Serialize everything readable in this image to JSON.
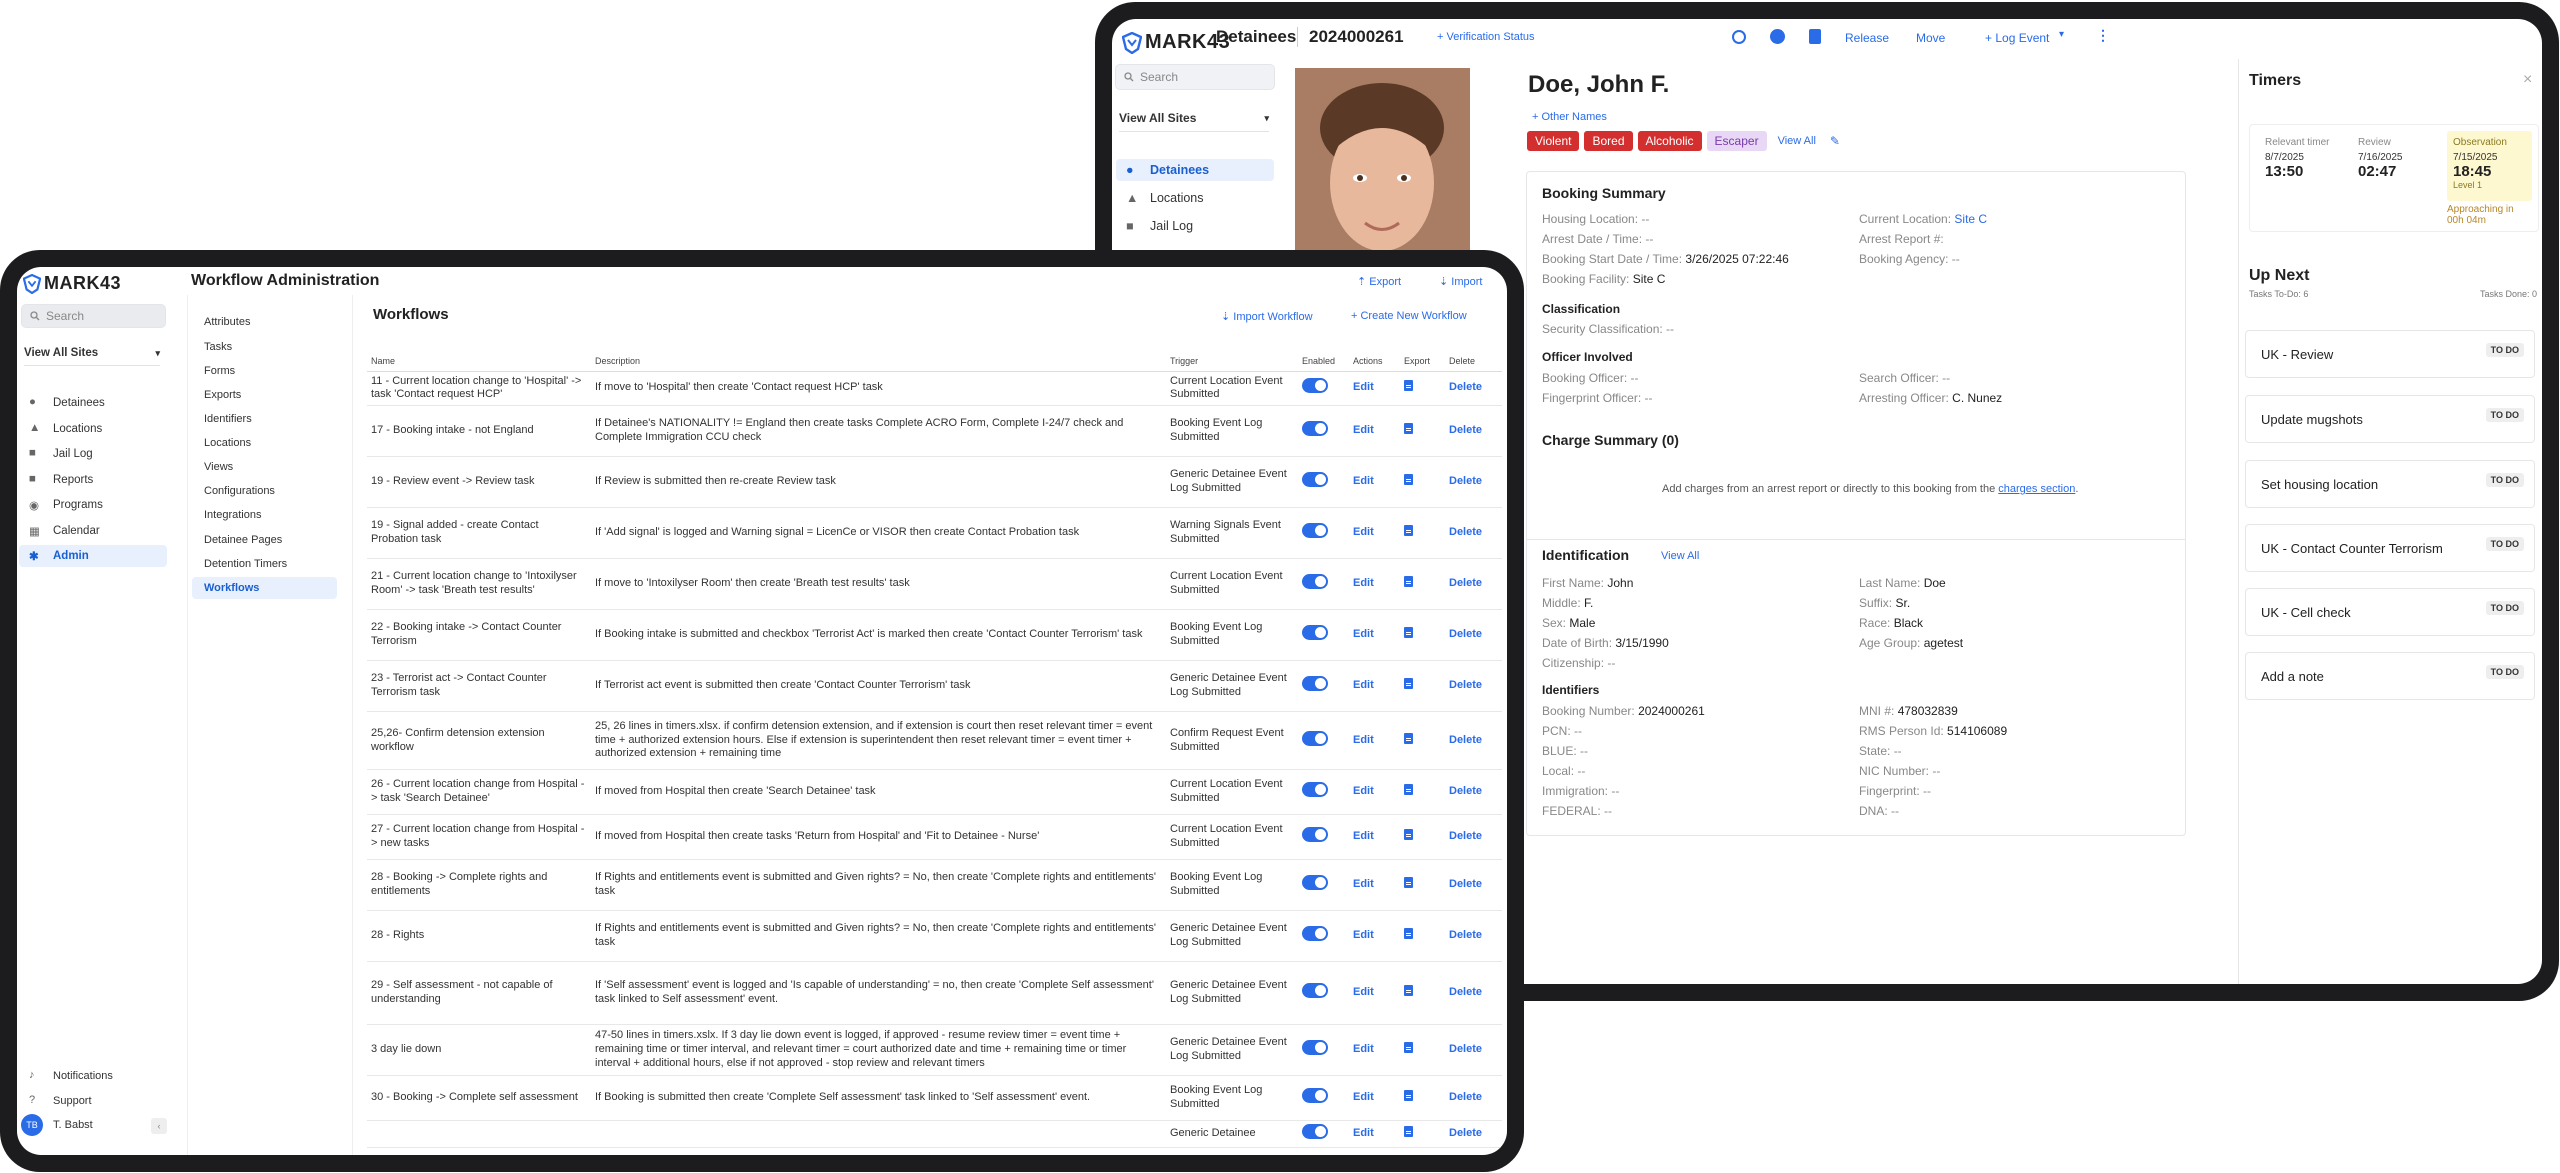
{
  "back": {
    "brand": "MARK43",
    "page_title": "Detainees",
    "booking_id": "2024000261",
    "verification_link": "Verification Status",
    "actions": [
      "Release",
      "Move",
      "Log Event"
    ],
    "search_placeholder": "Search",
    "site_selector": "View All Sites",
    "nav": [
      "Detainees",
      "Locations",
      "Jail Log"
    ],
    "person_name": "Doe, John F.",
    "other_names_link": "Other Names",
    "tags": [
      {
        "label": "Violent",
        "color": "#d32f2f"
      },
      {
        "label": "Bored",
        "color": "#d32f2f"
      },
      {
        "label": "Alcoholic",
        "color": "#d32f2f"
      },
      {
        "label": "Escaper",
        "color": "#e8d8f5"
      }
    ],
    "view_all": "View All",
    "booking_summary": {
      "heading": "Booking Summary",
      "housing_location": "Housing Location: --",
      "current_location_label": "Current Location:",
      "current_location": "Site C",
      "arrest_datetime": "Arrest Date / Time: --",
      "arrest_report": "Arrest Report #:",
      "booking_start_label": "Booking Start Date / Time:",
      "booking_start": "3/26/2025 07:22:46",
      "booking_agency": "Booking Agency: --",
      "booking_facility_label": "Booking Facility:",
      "booking_facility": "Site C",
      "classification_heading": "Classification",
      "security_classification": "Security Classification: --",
      "officer_heading": "Officer Involved",
      "booking_officer": "Booking Officer: --",
      "search_officer": "Search Officer: --",
      "fingerprint_officer": "Fingerprint Officer: --",
      "arresting_officer_label": "Arresting Officer:",
      "arresting_officer": "C. Nunez"
    },
    "charge_summary": {
      "heading": "Charge Summary (0)",
      "text": "Add charges from an arrest report or directly to this booking from the",
      "link": "charges section"
    },
    "identification": {
      "heading": "Identification",
      "view_all": "View All",
      "first_name_label": "First Name:",
      "first_name": "John",
      "last_name_label": "Last Name:",
      "last_name": "Doe",
      "middle_label": "Middle:",
      "middle": "F.",
      "suffix_label": "Suffix:",
      "suffix": "Sr.",
      "sex_label": "Sex:",
      "sex": "Male",
      "race_label": "Race:",
      "race": "Black",
      "dob_label": "Date of Birth:",
      "dob": "3/15/1990",
      "age_group_label": "Age Group:",
      "age_group": "agetest",
      "citizenship": "Citizenship: --"
    },
    "identifiers": {
      "heading": "Identifiers",
      "booking_number_label": "Booking Number:",
      "booking_number": "2024000261",
      "mni_label": "MNI #:",
      "mni": "478032839",
      "pcn": "PCN: --",
      "rms_label": "RMS Person Id:",
      "rms": "514106089",
      "blue": "BLUE: --",
      "state": "State: --",
      "local": "Local: --",
      "nic": "NIC Number: --",
      "immigration": "Immigration: --",
      "fingerprint": "Fingerprint: --",
      "federal": "FEDERAL: --",
      "dna": "DNA: --"
    },
    "timers": {
      "title": "Timers",
      "items": [
        {
          "label": "Relevant timer",
          "date": "8/7/2025",
          "time": "13:50"
        },
        {
          "label": "Review",
          "date": "7/16/2025",
          "time": "02:47"
        },
        {
          "label": "Observation",
          "date": "7/15/2025",
          "time": "18:45",
          "sub": "Level 1"
        }
      ],
      "approaching": "Approaching in 00h 04m",
      "up_next": "Up Next",
      "tasks_todo": "Tasks To-Do: 6",
      "tasks_done": "Tasks Done: 0",
      "tasks": [
        "UK - Review",
        "Update mugshots",
        "Set housing location",
        "UK - Contact Counter Terrorism",
        "UK - Cell check",
        "Add a note"
      ],
      "todo_badge": "TO DO"
    }
  },
  "front": {
    "brand": "MARK43",
    "page_title": "Workflow Administration",
    "export": "Export",
    "import": "Import",
    "search_placeholder": "Search",
    "site_selector": "View All Sites",
    "nav": [
      "Detainees",
      "Locations",
      "Jail Log",
      "Reports",
      "Programs",
      "Calendar",
      "Admin"
    ],
    "footer": [
      "Notifications",
      "Support"
    ],
    "user_initials": "TB",
    "user_name": "T. Babst",
    "admin_menu": [
      "Attributes",
      "Tasks",
      "Forms",
      "Exports",
      "Identifiers",
      "Locations",
      "Views",
      "Configurations",
      "Integrations",
      "Detainee Pages",
      "Detention Timers",
      "Workflows"
    ],
    "section_title": "Workflows",
    "import_workflow": "Import Workflow",
    "create_workflow": "Create New Workflow",
    "columns": [
      "Name",
      "Description",
      "Trigger",
      "Enabled",
      "Actions",
      "Export",
      "Delete"
    ],
    "edit_label": "Edit",
    "delete_label": "Delete",
    "rows": [
      {
        "name": "11 - Current location change to 'Hospital' -> task 'Contact request HCP'",
        "desc": "If move to 'Hospital' then create 'Contact request HCP' task",
        "trigger": "Current Location Event Submitted"
      },
      {
        "name": "17 - Booking intake - not England",
        "desc": "If Detainee's NATIONALITY != England then create tasks Complete ACRO Form, Complete I-24/7 check and Complete Immigration CCU check",
        "trigger": "Booking Event Log Submitted"
      },
      {
        "name": "19 - Review event -> Review task",
        "desc": "If Review is submitted then re-create Review task",
        "trigger": "Generic Detainee Event Log Submitted"
      },
      {
        "name": "19 - Signal added - create Contact Probation task",
        "desc": "If 'Add signal' is logged and Warning signal = LicenCe or VISOR then create Contact Probation task",
        "trigger": "Warning Signals Event Submitted"
      },
      {
        "name": "21 - Current location change to 'Intoxilyser Room' -> task 'Breath test results'",
        "desc": "If move to 'Intoxilyser Room' then create 'Breath test results' task",
        "trigger": "Current Location Event Submitted"
      },
      {
        "name": "22 - Booking intake -> Contact Counter Terrorism",
        "desc": "If Booking intake is submitted and checkbox 'Terrorist Act' is marked then create 'Contact Counter Terrorism' task",
        "trigger": "Booking Event Log Submitted"
      },
      {
        "name": "23 - Terrorist act -> Contact Counter Terrorism task",
        "desc": "If Terrorist act event is submitted then create 'Contact Counter Terrorism' task",
        "trigger": "Generic Detainee Event Log Submitted"
      },
      {
        "name": "25,26- Confirm detension extension workflow",
        "desc": "25, 26 lines in timers.xlsx. if confirm detension extension, and if extension is court then reset relevant timer = event time + authorized extension hours. Else if extension is superintendent then reset relevant timer = event timer + authorized extension + remaining time",
        "trigger": "Confirm Request Event Submitted"
      },
      {
        "name": "26 - Current location change from Hospital -> task 'Search Detainee'",
        "desc": "If moved from Hospital then create 'Search Detainee' task",
        "trigger": "Current Location Event Submitted"
      },
      {
        "name": "27 - Current location change from Hospital -> new tasks",
        "desc": "If moved from Hospital then create tasks 'Return from Hospital' and 'Fit to Detainee - Nurse'",
        "trigger": "Current Location Event Submitted"
      },
      {
        "name": "28 - Booking -> Complete rights and entitlements",
        "desc": "If Rights and entitlements event is submitted and Given rights? = No, then create 'Complete rights and entitlements' task",
        "trigger": "Booking Event Log Submitted"
      },
      {
        "name": "28 - Rights",
        "desc": "If Rights and entitlements event is submitted and Given rights? = No, then create 'Complete rights and entitlements' task",
        "trigger": "Generic Detainee Event Log Submitted"
      },
      {
        "name": "29 - Self assessment - not capable of understanding",
        "desc": "If 'Self assessment' event is logged and 'Is capable of understanding' = no, then create 'Complete Self assessment' task linked to Self assessment' event.",
        "trigger": "Generic Detainee Event Log Submitted"
      },
      {
        "name": "3 day lie down",
        "desc": "47-50 lines in timers.xslx. If 3 day lie down event is logged, if approved - resume review timer = event time + remaining time or timer interval, and relevant timer = court authorized date and time + remaining time or timer interval + additional hours, else if not approved - stop review and relevant timers",
        "trigger": "Generic Detainee Event Log Submitted"
      },
      {
        "name": "30 - Booking -> Complete self assessment",
        "desc": "If Booking is submitted then create 'Complete Self assessment' task linked to 'Self assessment' event.",
        "trigger": "Booking Event Log Submitted"
      },
      {
        "name": "",
        "desc": "",
        "trigger": "Generic Detainee"
      }
    ]
  }
}
